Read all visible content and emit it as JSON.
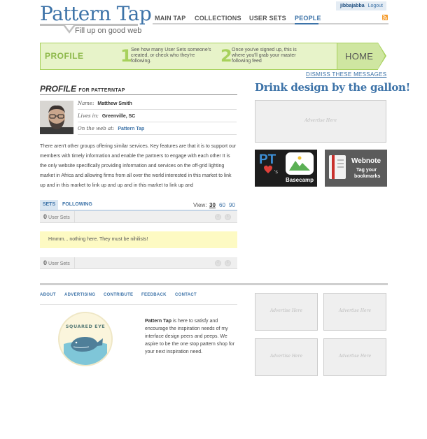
{
  "header": {
    "logo_title": "Pattern Tap",
    "logo_tagline": "Fill up on good web",
    "user": {
      "name": "jibbajabba",
      "logout": "Logout"
    },
    "nav": [
      {
        "label": "MAIN TAP"
      },
      {
        "label": "COLLECTIONS"
      },
      {
        "label": "USER SETS"
      },
      {
        "label": "PEOPLE",
        "active": true
      }
    ],
    "rss_icon": "rss-icon"
  },
  "banner": {
    "title": "PROFILE",
    "step1_num": "1",
    "step1_text": "See how many User Sets someone's created, or check who they're following.",
    "step2_num": "2",
    "step2_text": "Once you've signed up, this is where you'll grab your master following feed",
    "home_label": "HOME",
    "dismiss": "DISMISS THESE MESSAGES"
  },
  "profile": {
    "heading": "PROFILE",
    "heading_for": "FOR PATTERNTAP",
    "name_label": "Name:",
    "name_value": "Matthew Smith",
    "lives_label": "Lives in:",
    "lives_value": "Greenville, SC",
    "web_label": "On the web at:",
    "web_value": "Pattern Tap",
    "bio": "There aren't other groups offering similar services. Key features are that it is to support our members with timely information and enable the partners to engage with each other It is the only website specifically providing information and services on the off-grid lighting market in Africa and allowing firms from all over the world interested in this market to link up and in this market to link up and up and in this market to link up and"
  },
  "tabs": {
    "sets": "SETS",
    "following": "FOLLOWING",
    "view_label": "View:",
    "view_options": [
      "30",
      "60",
      "90"
    ],
    "selected_view": "30"
  },
  "sets_bar": {
    "count": "0",
    "label": "User Sets"
  },
  "notice": "Hmmm... nothing here. They must be nihilists!",
  "sidebar": {
    "tagline": "Drink design by the gallon!",
    "ad_text": "Advertise Here",
    "promo_basecamp": {
      "pt": "PT",
      "s": "'s",
      "brand": "Basecamp"
    },
    "promo_webnote": {
      "brand": "Webnote",
      "line1": "Tag your",
      "line2": "bookmarks"
    }
  },
  "footer": {
    "links": [
      "ABOUT",
      "ADVERTISING",
      "CONTRIBUTE",
      "FEEDBACK",
      "CONTACT"
    ],
    "badge_text": "SQUARED EYE",
    "about_bold": "Pattern Tap",
    "about_text": " is here to satisfy and encourage the inspiration needs of my interface design peers and peeps. We aspire to be the one stop pattern shop for your next inspiration need.",
    "ad_text": "Advertise Here"
  },
  "colors": {
    "brand_blue": "#3d73a8",
    "banner_green": "#a7d15c",
    "banner_bg": "#e7f3c9",
    "notice_yellow": "#fdfac3"
  }
}
